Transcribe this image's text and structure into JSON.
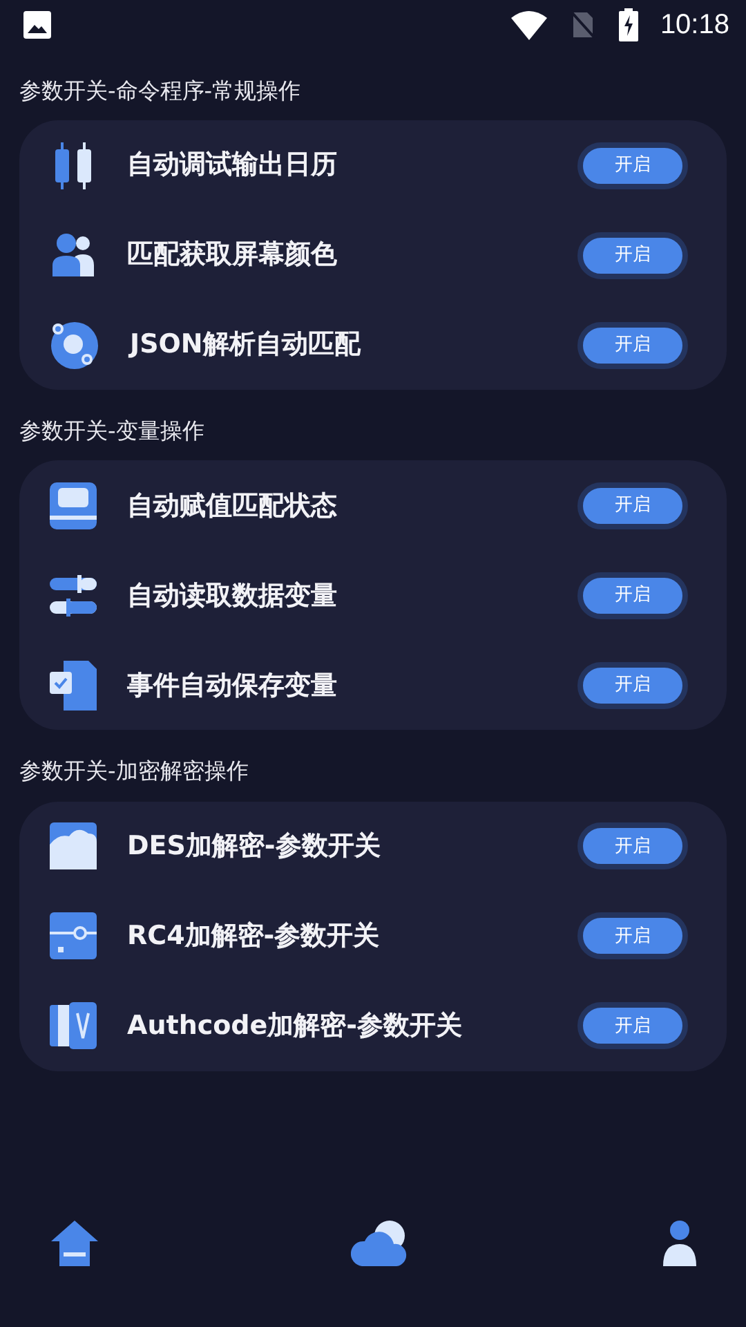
{
  "status_bar": {
    "time": "10:18"
  },
  "sections": [
    {
      "title": "参数开关-命令程序-常规操作",
      "items": [
        {
          "label": "自动调试输出日历",
          "button": "开启"
        },
        {
          "label": "匹配获取屏幕颜色",
          "button": "开启"
        },
        {
          "label": "JSON解析自动匹配",
          "button": "开启"
        }
      ]
    },
    {
      "title": "参数开关-变量操作",
      "items": [
        {
          "label": "自动赋值匹配状态",
          "button": "开启"
        },
        {
          "label": "自动读取数据变量",
          "button": "开启"
        },
        {
          "label": "事件自动保存变量",
          "button": "开启"
        }
      ]
    },
    {
      "title": "参数开关-加密解密操作",
      "items": [
        {
          "label": "DES加解密-参数开关",
          "button": "开启"
        },
        {
          "label": "RC4加解密-参数开关",
          "button": "开启"
        },
        {
          "label": "Authcode加解密-参数开关",
          "button": "开启"
        }
      ]
    }
  ]
}
